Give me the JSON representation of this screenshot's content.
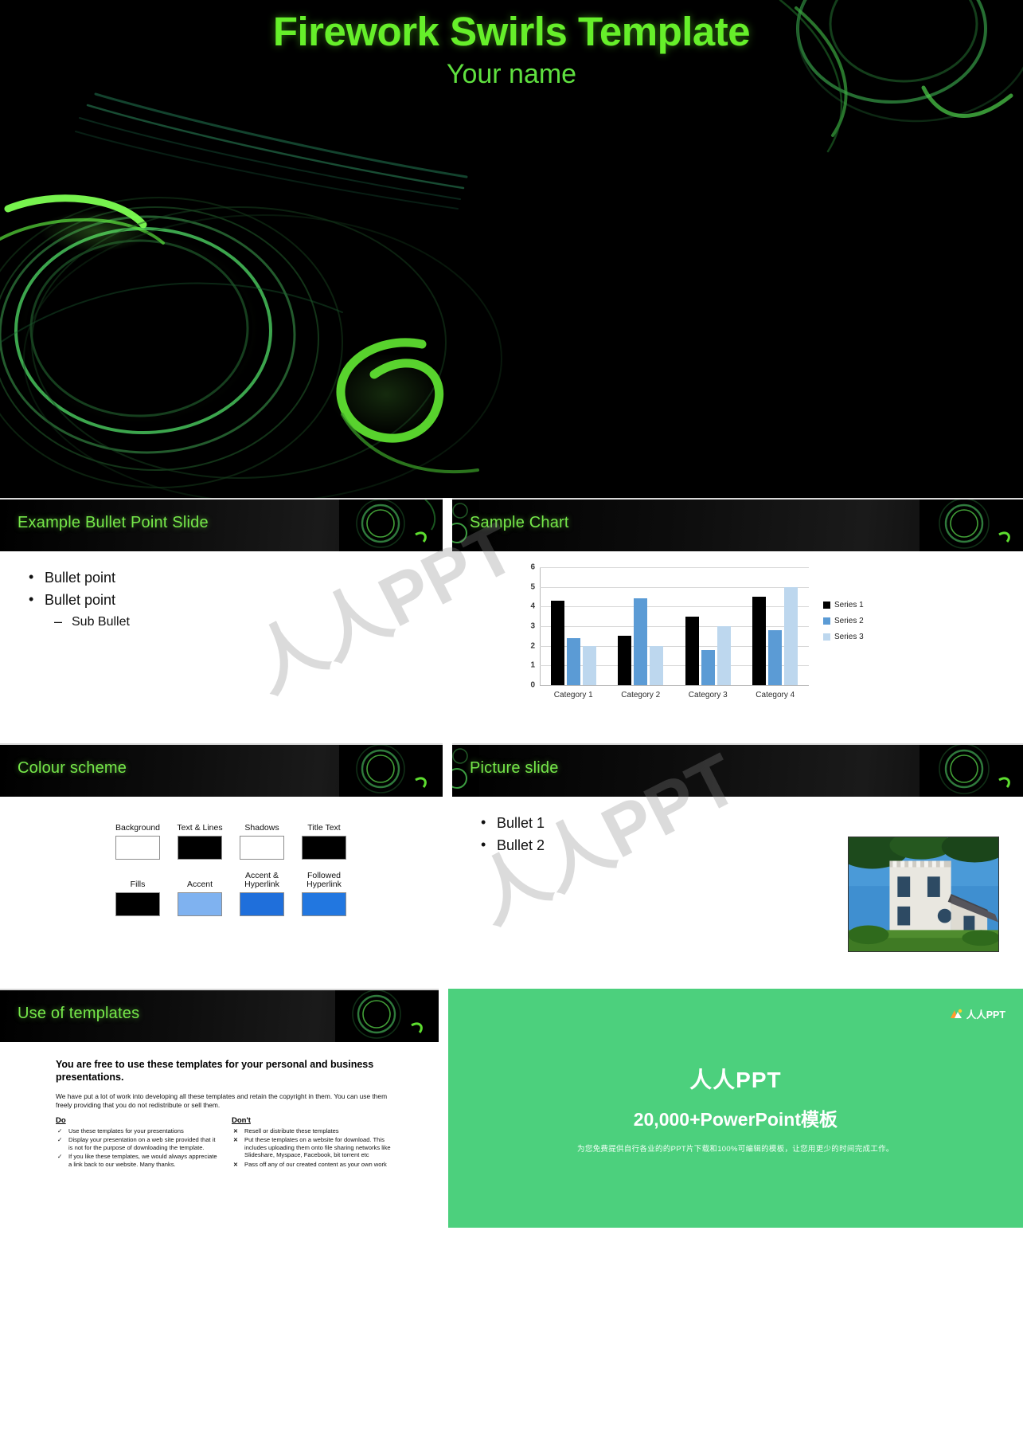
{
  "deck": {
    "title": "Firework Swirls Template",
    "subtitle": "Your name",
    "accent_green": "#66ef2a",
    "header_green": "#76e84a",
    "background": "#000000"
  },
  "watermark": {
    "text_1": "人人PPT",
    "text_2": "人人PPT"
  },
  "slides": {
    "bullet_slide": {
      "title": "Example Bullet Point Slide",
      "bullets": [
        {
          "text": "Bullet point",
          "level": 1
        },
        {
          "text": "Bullet point",
          "level": 1
        },
        {
          "text": "Sub Bullet",
          "level": 2
        }
      ]
    },
    "chart_slide": {
      "title": "Sample Chart"
    },
    "colour_slide": {
      "title": "Colour scheme",
      "swatches": [
        {
          "label": "Background",
          "color": "#ffffff"
        },
        {
          "label": "Text & Lines",
          "color": "#000000"
        },
        {
          "label": "Shadows",
          "color": "#ffffff"
        },
        {
          "label": "Title Text",
          "color": "#000000"
        },
        {
          "label": "Fills",
          "color": "#000000"
        },
        {
          "label": "Accent",
          "color": "#7fb2f0"
        },
        {
          "label": "Accent & Hyperlink",
          "color": "#1f6fdb"
        },
        {
          "label": "Followed Hyperlink",
          "color": "#2277e0"
        }
      ]
    },
    "picture_slide": {
      "title": "Picture slide",
      "bullets": [
        {
          "text": "Bullet 1"
        },
        {
          "text": "Bullet 2"
        }
      ]
    },
    "use_slide": {
      "title": "Use of templates",
      "headline": "You are free to use these templates for your personal and business presentations.",
      "paragraph": "We have put a lot of work into developing all these templates and retain the copyright in them.  You can use them freely providing that you do not redistribute or sell them.",
      "do_title": "Do",
      "do_items": [
        "Use these templates for your presentations",
        "Display your presentation on a web site provided that it is not for the purpose of downloading the template.",
        "If you like these templates, we would always appreciate a link back to our website.  Many thanks."
      ],
      "dont_title": "Don't",
      "dont_items": [
        "Resell or distribute these templates",
        "Put these templates on a website for download.  This includes uploading them onto file sharing networks like Slideshare, Myspace, Facebook, bit torrent etc",
        "Pass off any of our created content as your own work"
      ]
    },
    "brand_panel": {
      "logo_text": "人人PPT",
      "line_1": "人人PPT",
      "line_2": "20,000+PowerPoint模板",
      "line_3": "为您免费提供自行各业的的PPT片下载和100%可编辑的模板，让您用更少的时间完成工作。",
      "background_color": "#4cd07d"
    }
  },
  "chart_data": {
    "type": "bar",
    "title": "Sample Chart",
    "categories": [
      "Category 1",
      "Category 2",
      "Category 3",
      "Category 4"
    ],
    "series": [
      {
        "name": "Series 1",
        "color": "#000000",
        "values": [
          4.3,
          2.5,
          3.5,
          4.5
        ]
      },
      {
        "name": "Series 2",
        "color": "#5b9bd5",
        "values": [
          2.4,
          4.4,
          1.8,
          2.8
        ]
      },
      {
        "name": "Series 3",
        "color": "#bdd7ee",
        "values": [
          2.0,
          2.0,
          3.0,
          5.0
        ]
      }
    ],
    "ylim": [
      0,
      6
    ],
    "yticks": [
      0,
      1,
      2,
      3,
      4,
      5,
      6
    ],
    "xlabel": "",
    "ylabel": "",
    "grid": true,
    "legend_position": "right"
  }
}
